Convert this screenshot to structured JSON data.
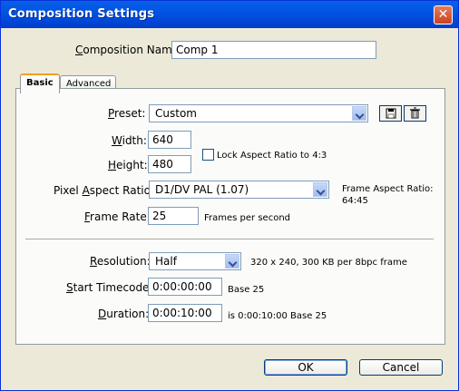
{
  "window": {
    "title": "Composition Settings",
    "close_glyph": "✕"
  },
  "comp_name": {
    "label_first": "C",
    "label_rest": "omposition Name:",
    "value": "Comp 1"
  },
  "tabs": [
    {
      "label": "Basic"
    },
    {
      "label": "Advanced"
    }
  ],
  "preset": {
    "label_first": "P",
    "label_rest": "reset:",
    "value": "Custom"
  },
  "width": {
    "label_first": "W",
    "label_rest": "idth:",
    "value": "640"
  },
  "height": {
    "label_first": "H",
    "label_rest": "eight:",
    "value": "480"
  },
  "lock_aspect": {
    "label": "Lock Aspect Ratio to 4:3",
    "checked": false
  },
  "pixel_aspect": {
    "label_before": "Pixel ",
    "label_first": "A",
    "label_rest": "spect Ratio:",
    "value": "D1/DV PAL (1.07)"
  },
  "frame_aspect": {
    "line1": "Frame Aspect Ratio:",
    "line2": "64:45"
  },
  "frame_rate": {
    "label_first": "F",
    "label_rest": "rame Rate:",
    "value": "25",
    "unit": "Frames per second"
  },
  "resolution": {
    "label_first": "R",
    "label_rest": "esolution:",
    "value": "Half",
    "info": "320 x 240, 300 KB per 8bpc frame"
  },
  "start_timecode": {
    "label_first": "S",
    "label_rest": "tart Timecode:",
    "value": "0:00:00:00",
    "info": "Base 25"
  },
  "duration": {
    "label_first": "D",
    "label_rest": "uration:",
    "value": "0:00:10:00",
    "info": "is 0:00:10:00  Base 25"
  },
  "buttons": {
    "ok": "OK",
    "cancel": "Cancel"
  }
}
